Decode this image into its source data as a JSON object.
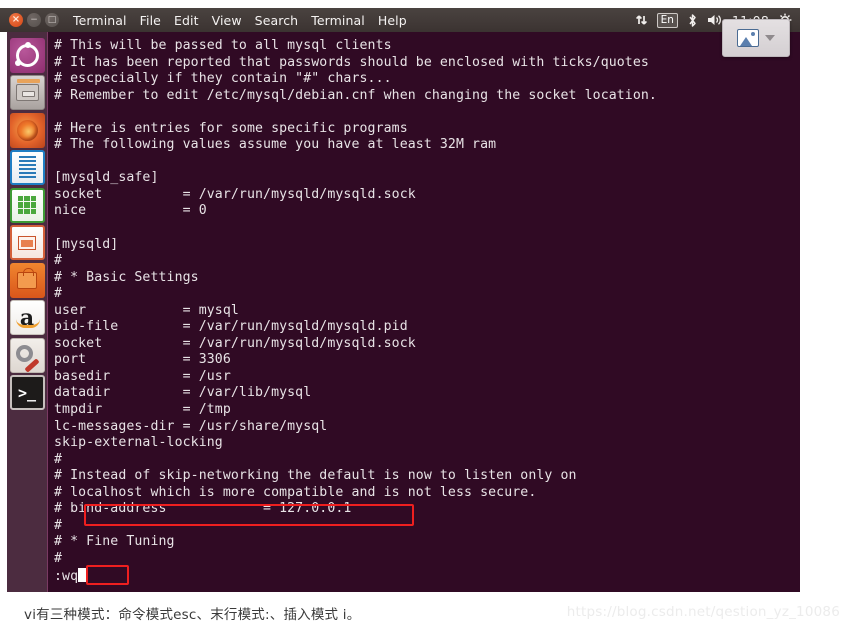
{
  "window": {
    "title": "Terminal",
    "controls": {
      "close": "×",
      "minimize": "−",
      "maximize": "□"
    },
    "menus": [
      "Terminal",
      "File",
      "Edit",
      "View",
      "Search",
      "Terminal",
      "Help"
    ]
  },
  "tray": {
    "network_icon": "up-down-arrows-icon",
    "keyboard_layout": "En",
    "bluetooth_icon": "bluetooth-icon",
    "volume_icon": "volume-icon",
    "clock": "11:08",
    "power_icon": "gear-power-icon"
  },
  "tool_popup": {
    "image_icon": "picture-icon",
    "chevron": "chevron-down-icon"
  },
  "launcher": {
    "items": [
      {
        "name": "ubuntu-dash",
        "label": "Ubuntu Dash",
        "running": false
      },
      {
        "name": "files",
        "label": "Files",
        "running": false
      },
      {
        "name": "firefox",
        "label": "Firefox Web Browser",
        "running": true
      },
      {
        "name": "libreoffice-writer",
        "label": "LibreOffice Writer",
        "running": false
      },
      {
        "name": "libreoffice-calc",
        "label": "LibreOffice Calc",
        "running": false
      },
      {
        "name": "libreoffice-impress",
        "label": "LibreOffice Impress",
        "running": false
      },
      {
        "name": "ubuntu-software",
        "label": "Ubuntu Software",
        "running": false
      },
      {
        "name": "amazon",
        "label": "Amazon",
        "running": false
      },
      {
        "name": "system-settings",
        "label": "System Settings",
        "running": false
      },
      {
        "name": "terminal",
        "label": "Terminal",
        "running": true
      }
    ]
  },
  "terminal": {
    "background_color": "#300a24",
    "foreground_color": "#e8e3e6",
    "lines": [
      "# This will be passed to all mysql clients",
      "# It has been reported that passwords should be enclosed with ticks/quotes",
      "# escpecially if they contain \"#\" chars...",
      "# Remember to edit /etc/mysql/debian.cnf when changing the socket location.",
      "",
      "# Here is entries for some specific programs",
      "# The following values assume you have at least 32M ram",
      "",
      "[mysqld_safe]",
      "socket          = /var/run/mysqld/mysqld.sock",
      "nice            = 0",
      "",
      "[mysqld]",
      "#",
      "# * Basic Settings",
      "#",
      "user            = mysql",
      "pid-file        = /var/run/mysqld/mysqld.pid",
      "socket          = /var/run/mysqld/mysqld.sock",
      "port            = 3306",
      "basedir         = /usr",
      "datadir         = /var/lib/mysql",
      "tmpdir          = /tmp",
      "lc-messages-dir = /usr/share/mysql",
      "skip-external-locking",
      "#",
      "# Instead of skip-networking the default is now to listen only on",
      "# localhost which is more compatible and is not less secure.",
      "# bind-address            = 127.0.0.1",
      "#",
      "# * Fine Tuning",
      "#"
    ],
    "vi_command": ":wq"
  },
  "annotations": {
    "highlight_color": "#ee1f1f",
    "boxes": [
      {
        "name": "bind-address-highlight",
        "target": "# bind-address            = 127.0.0.1"
      },
      {
        "name": "vi-write-quit-highlight",
        "target": ":wq"
      }
    ]
  },
  "caption": {
    "text": "vi有三种模式：命令模式esc、末行模式:、插入模式 i。",
    "watermark": "https://blog.csdn.net/qestion_yz_10086"
  }
}
